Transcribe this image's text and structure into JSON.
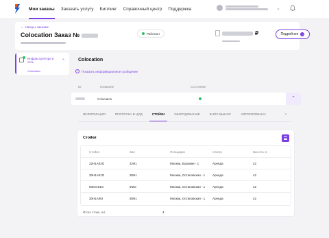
{
  "nav": {
    "items": [
      {
        "label": "Мои заказы",
        "active": true
      },
      {
        "label": "Заказать услугу",
        "active": false
      },
      {
        "label": "Биллинг",
        "active": false
      },
      {
        "label": "Справочный центр",
        "active": false
      },
      {
        "label": "Поддержка",
        "active": false
      }
    ]
  },
  "order": {
    "back_label": "Назад к заказам",
    "title": "Colocation Заказ №",
    "status": "Работает",
    "more_label": "Подробнее",
    "currency": "₽"
  },
  "sidebar": {
    "section_title": "Инфраструктура и сеть",
    "sub_item": "Colocation"
  },
  "service": {
    "title": "Colocation",
    "info_link": "Показать информационное сообщение",
    "columns": {
      "id": "ID",
      "name": "Название",
      "state": "Состояние"
    },
    "row": {
      "name": "Colocation"
    }
  },
  "tabs": [
    {
      "label": "ИНФОРМАЦИЯ",
      "active": false
    },
    {
      "label": "ПРОПУСКА В ЦОД",
      "active": false
    },
    {
      "label": "СТОЙКИ",
      "active": true
    },
    {
      "label": "ОБОРУДОВАНИЕ",
      "active": false
    },
    {
      "label": "ВНОС-ВЫНОС",
      "active": false
    },
    {
      "label": "АВТОРИЗОВАНН",
      "active": false
    }
  ],
  "racks": {
    "title": "Стойки",
    "columns": [
      "Стойка",
      "Зал",
      "Площадка",
      "Статус",
      "Высота, U"
    ],
    "rows": [
      [
        "22H1A02O",
        "22H1",
        "Москва, Боровая - 1",
        "Аренда",
        "42"
      ],
      [
        "30H1A01O",
        "30H1",
        "Москва, Остаповская - 1",
        "Аренда",
        "42"
      ],
      [
        "9I2OA01O",
        "9I2O",
        "Москва, Остаповская - 1",
        "Аренда",
        "42"
      ],
      [
        "30H1A00I",
        "30H1",
        "Москва, Остаповская - 1",
        "Аренда",
        "42"
      ]
    ],
    "total_label": "Итого стоек, шт.",
    "total_value": "4"
  },
  "colors": {
    "accent": "#7b3fe4",
    "status_ok": "#2dbe63"
  },
  "icons": [
    "logo-icon",
    "bell-icon",
    "arrow-left-icon",
    "copy-icon",
    "document-icon",
    "ruble-icon",
    "arrow-right-icon",
    "infrastructure-icon",
    "chevron-up-icon",
    "info-icon",
    "chevron-right-icon",
    "settings-icon"
  ]
}
